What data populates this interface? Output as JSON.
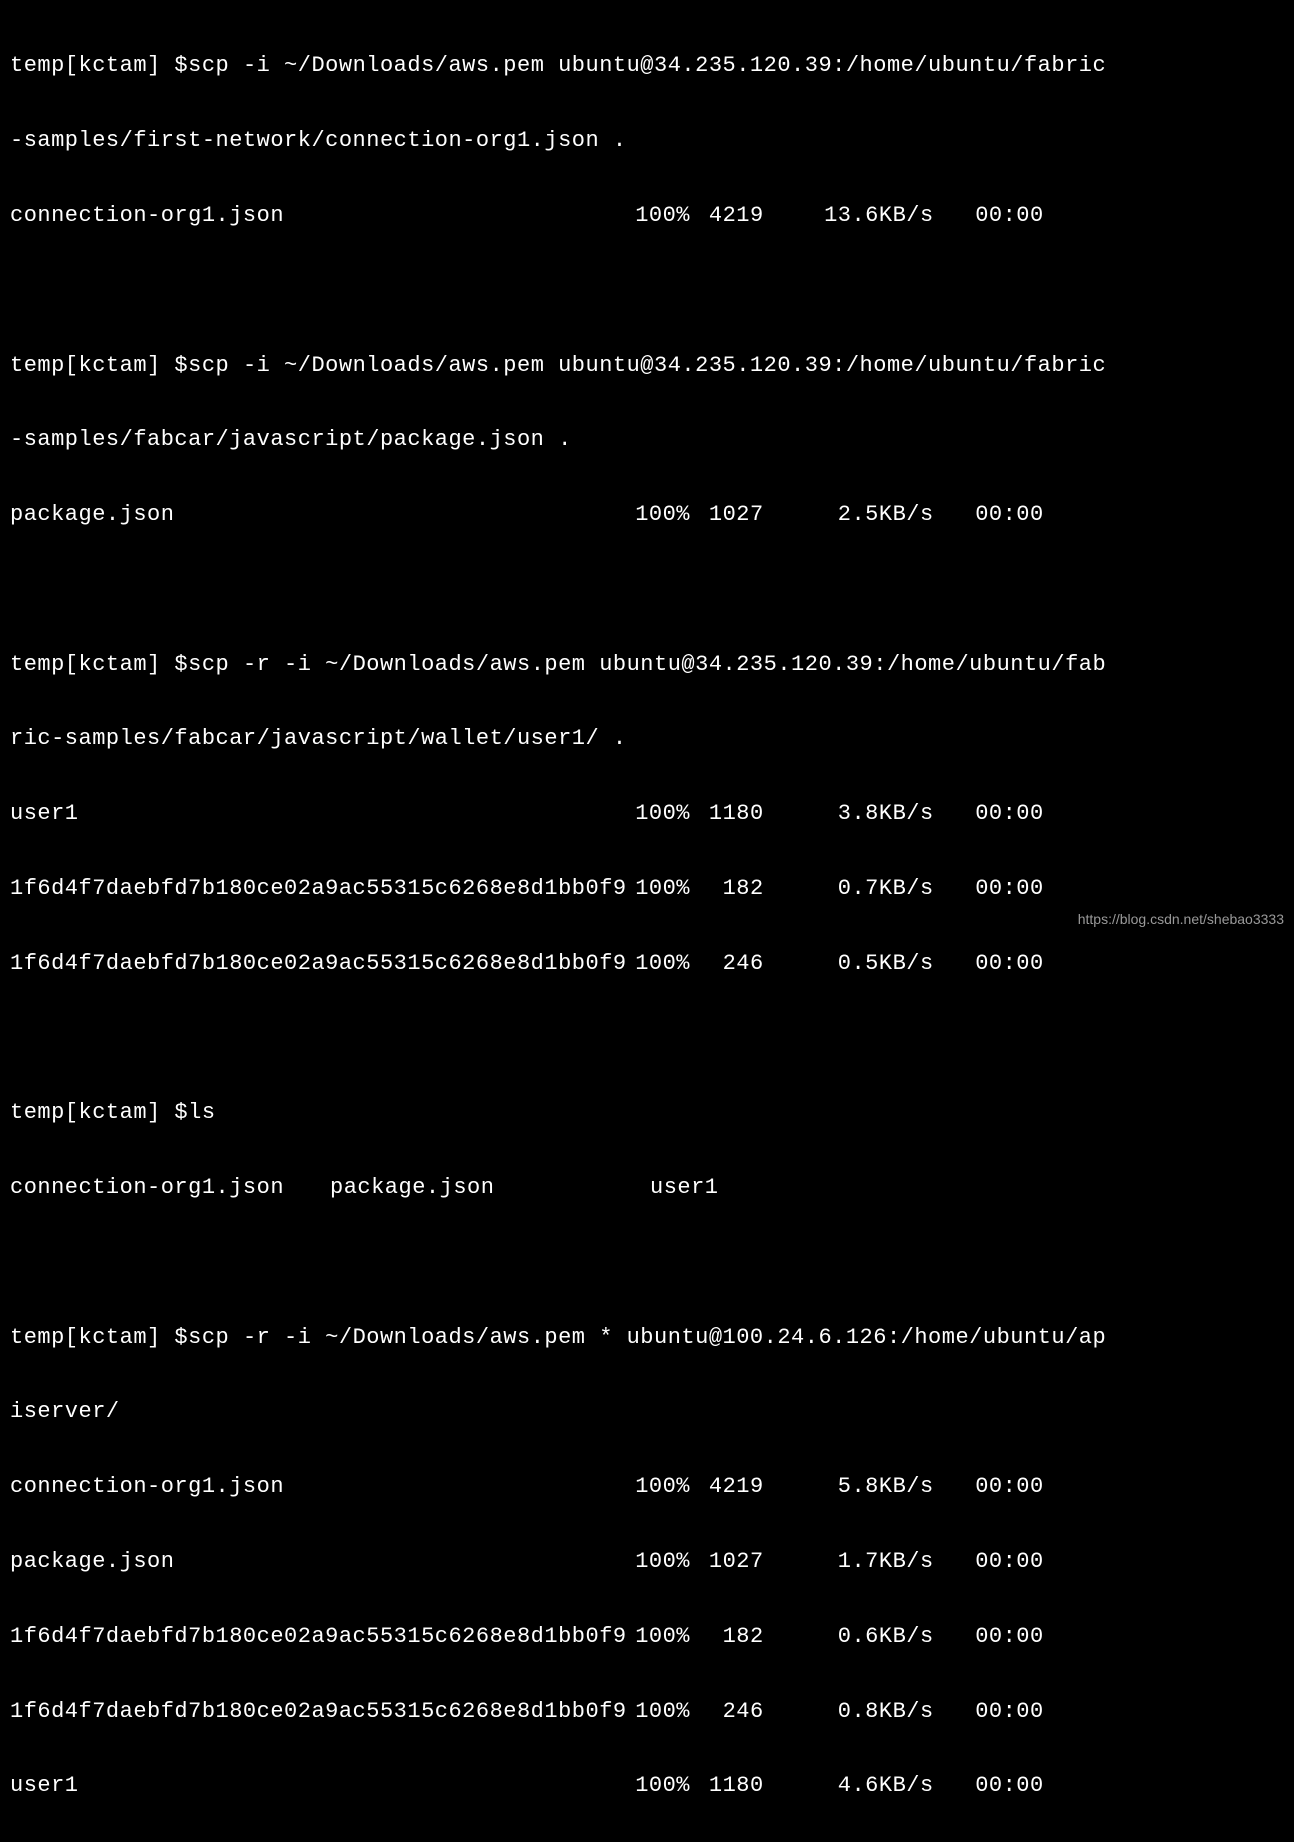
{
  "prompt": "temp[kctam] $",
  "commands": {
    "cmd1": "scp -i ~/Downloads/aws.pem ubuntu@34.235.120.39:/home/ubuntu/fabric",
    "cmd1_cont": "-samples/first-network/connection-org1.json .",
    "cmd2": "scp -i ~/Downloads/aws.pem ubuntu@34.235.120.39:/home/ubuntu/fabric",
    "cmd2_cont": "-samples/fabcar/javascript/package.json .",
    "cmd3": "scp -r -i ~/Downloads/aws.pem ubuntu@34.235.120.39:/home/ubuntu/fab",
    "cmd3_cont": "ric-samples/fabcar/javascript/wallet/user1/ .",
    "cmd4": "ls",
    "cmd5": "scp -r -i ~/Downloads/aws.pem * ubuntu@100.24.6.126:/home/ubuntu/ap",
    "cmd5_cont": "iserver/"
  },
  "transfers": {
    "t1": {
      "file": "connection-org1.json",
      "percent": "100%",
      "size": "4219",
      "speed": "13.6KB/s",
      "time": "00:00"
    },
    "t2": {
      "file": "package.json",
      "percent": "100%",
      "size": "1027",
      "speed": "2.5KB/s",
      "time": "00:00"
    },
    "t3": {
      "file": "user1",
      "percent": "100%",
      "size": "1180",
      "speed": "3.8KB/s",
      "time": "00:00"
    },
    "t4": {
      "file": "1f6d4f7daebfd7b180ce02a9ac55315c6268e8d1bb0f9",
      "percent": "100%",
      "size": "182",
      "speed": "0.7KB/s",
      "time": "00:00"
    },
    "t5": {
      "file": "1f6d4f7daebfd7b180ce02a9ac55315c6268e8d1bb0f9",
      "percent": "100%",
      "size": "246",
      "speed": "0.5KB/s",
      "time": "00:00"
    },
    "t6": {
      "file": "connection-org1.json",
      "percent": "100%",
      "size": "4219",
      "speed": "5.8KB/s",
      "time": "00:00"
    },
    "t7": {
      "file": "package.json",
      "percent": "100%",
      "size": "1027",
      "speed": "1.7KB/s",
      "time": "00:00"
    },
    "t8": {
      "file": "1f6d4f7daebfd7b180ce02a9ac55315c6268e8d1bb0f9",
      "percent": "100%",
      "size": "182",
      "speed": "0.6KB/s",
      "time": "00:00"
    },
    "t9": {
      "file": "1f6d4f7daebfd7b180ce02a9ac55315c6268e8d1bb0f9",
      "percent": "100%",
      "size": "246",
      "speed": "0.8KB/s",
      "time": "00:00"
    },
    "t10": {
      "file": "user1",
      "percent": "100%",
      "size": "1180",
      "speed": "4.6KB/s",
      "time": "00:00"
    }
  },
  "ls_output": {
    "item1": "connection-org1.json",
    "item2": "package.json",
    "item3": "user1"
  },
  "watermark": "https://blog.csdn.net/shebao3333"
}
